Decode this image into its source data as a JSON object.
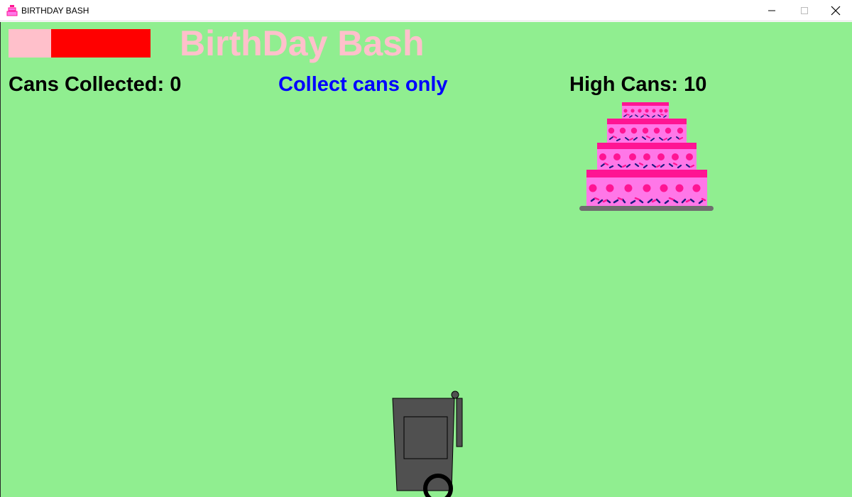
{
  "window": {
    "title": "BIRTHDAY BASH",
    "app_icon": "cake-icon",
    "controls": [
      "minimize-icon",
      "maximize-icon",
      "close-icon"
    ]
  },
  "game": {
    "title": "BirthDay Bash",
    "health_fraction": 0.3,
    "score_text": "Cans Collected: 0",
    "instruction_text": "Collect cans only",
    "high_score_text": "High Cans: 10",
    "sprites": [
      "cake",
      "trash-bin"
    ],
    "colors": {
      "background": "#90ee90",
      "title": "#ffc0cb",
      "health_remaining": "#ffc0cb",
      "health_empty": "#ff0000",
      "instruction": "#0000ff",
      "text": "#000000",
      "cake_body": "#ff77e8",
      "cake_trim": "#ff1493",
      "bin": "#505050"
    }
  }
}
